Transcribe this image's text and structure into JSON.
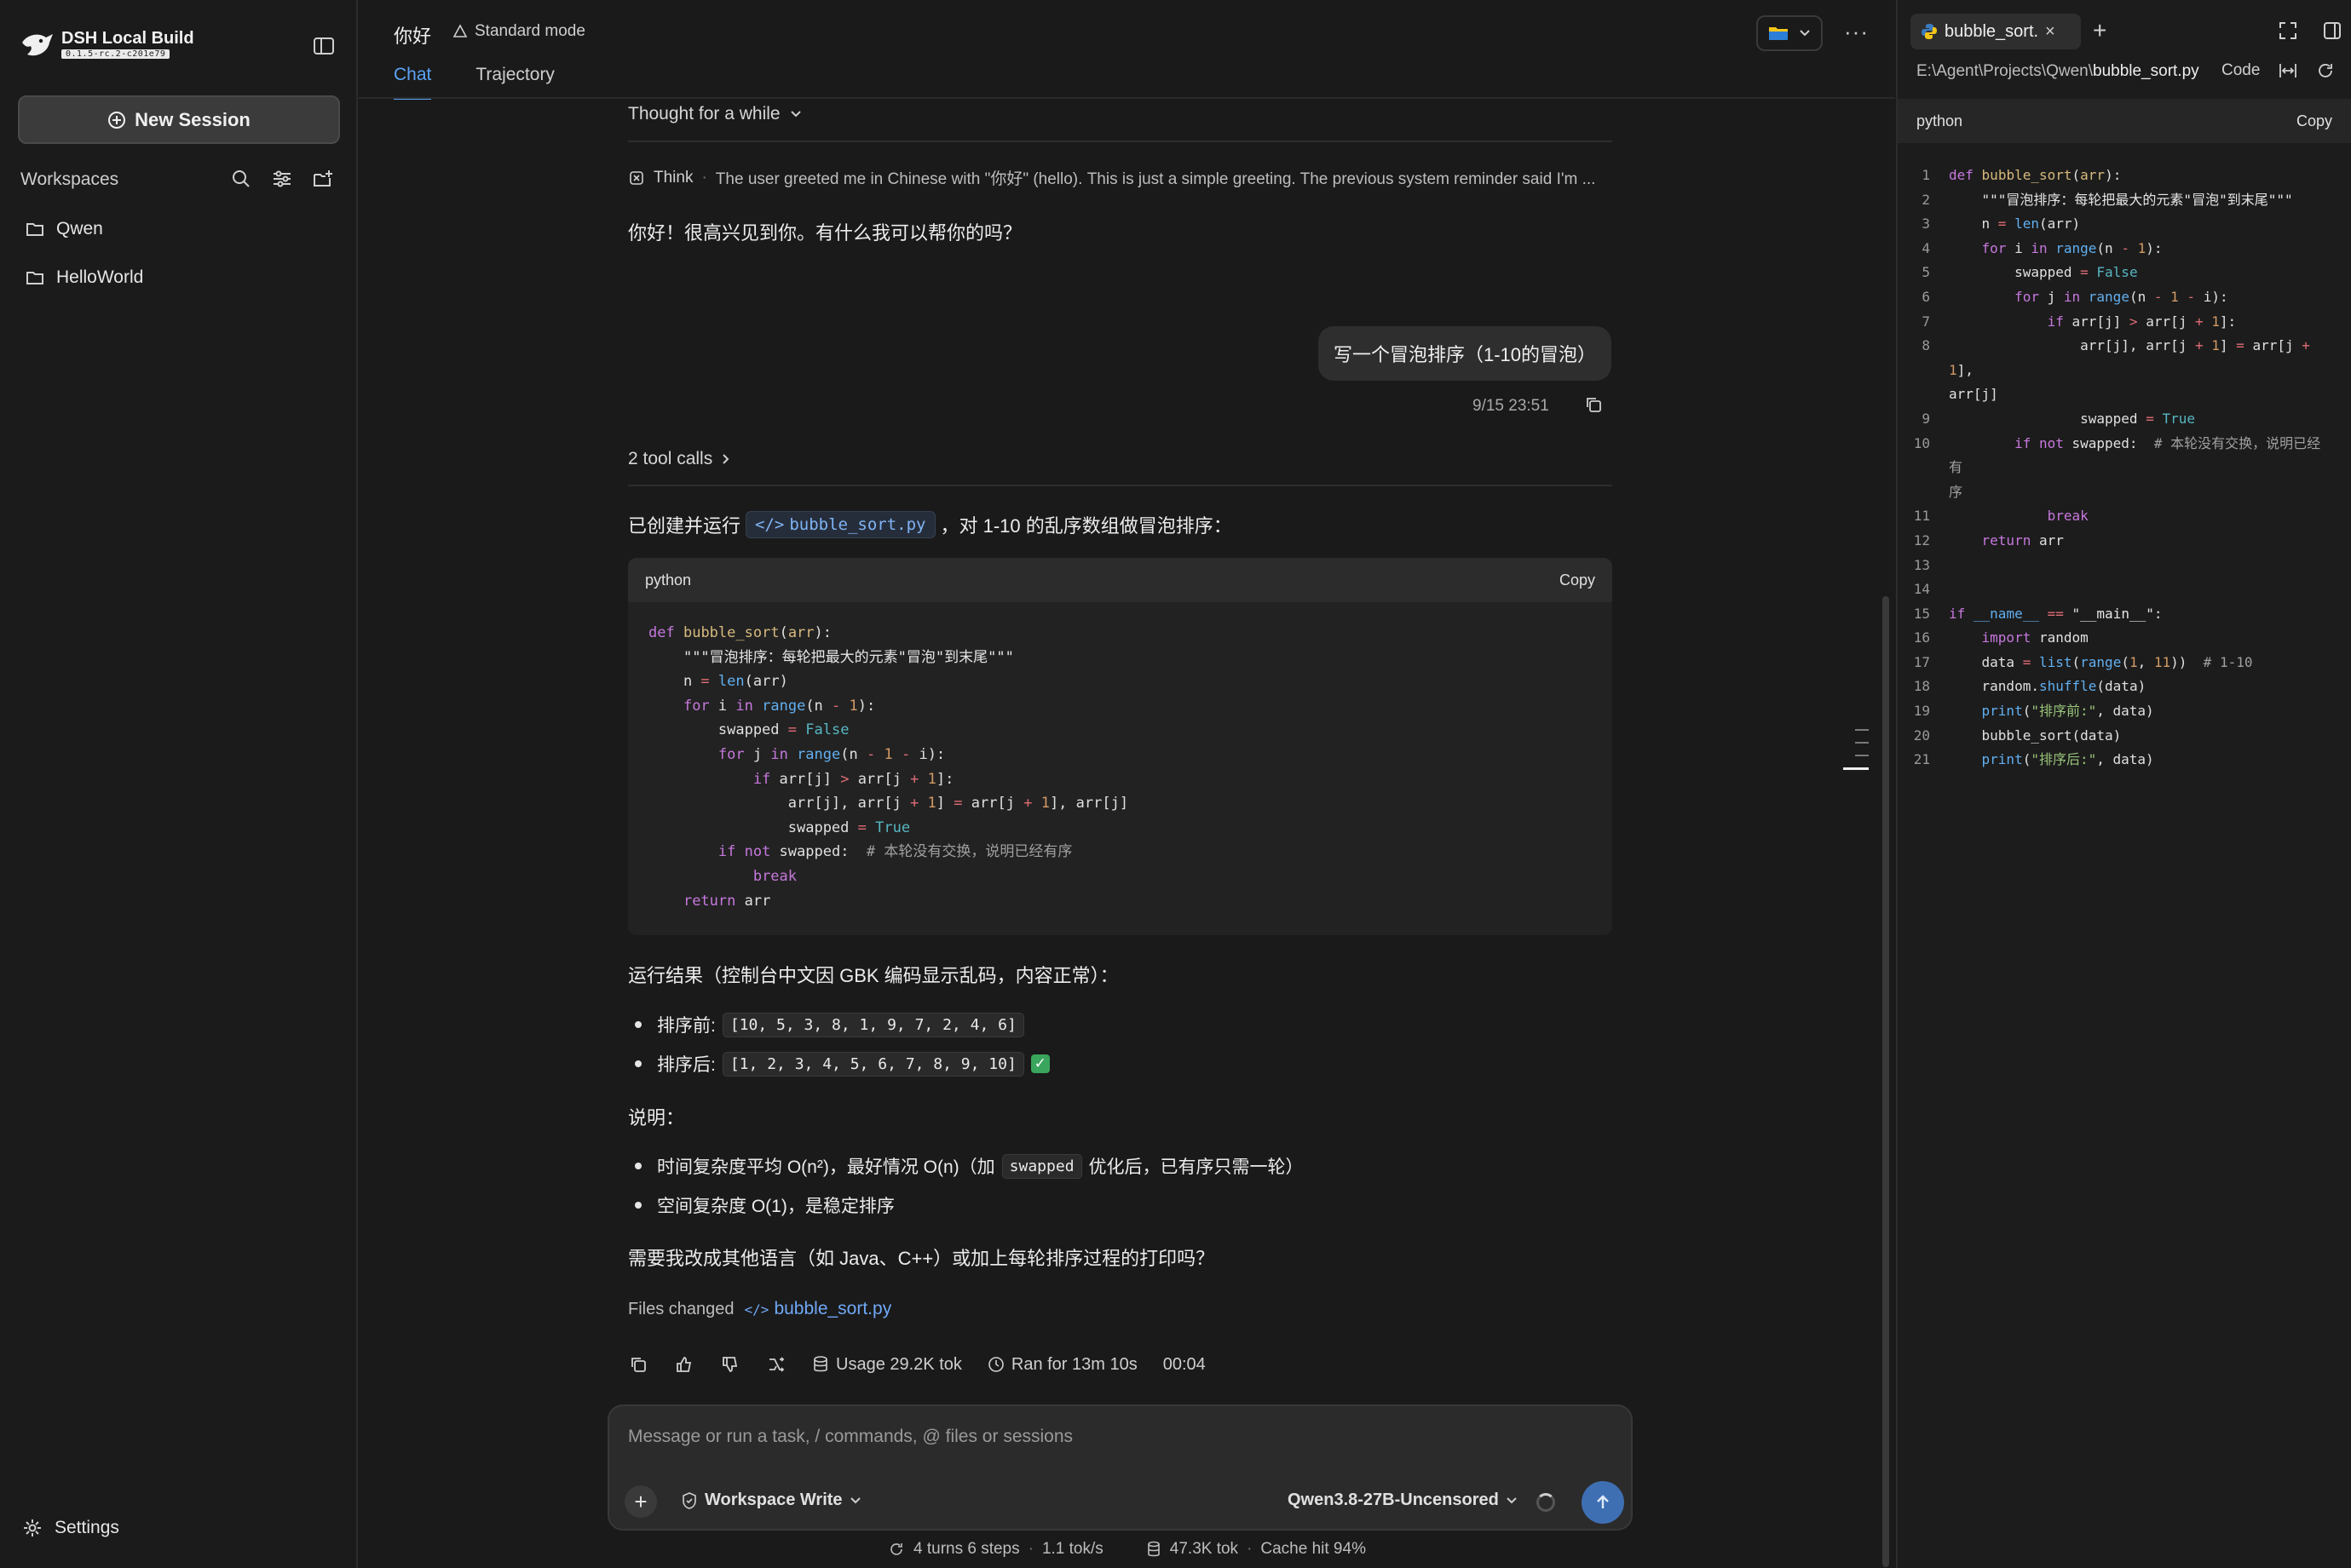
{
  "app": {
    "brand": "DSH Local Build",
    "version": "0.1.5-rc.2-c201e79"
  },
  "sidebar": {
    "new_session": "New Session",
    "workspaces_title": "Workspaces",
    "items": [
      {
        "label": "Qwen"
      },
      {
        "label": "HelloWorld"
      }
    ],
    "settings": "Settings"
  },
  "header": {
    "title": "你好",
    "mode": "Standard mode",
    "tabs": [
      {
        "label": "Chat",
        "active": true
      },
      {
        "label": "Trajectory",
        "active": false
      }
    ]
  },
  "chat": {
    "thought_label": "Thought for a while",
    "think_label": "Think",
    "think_text": "The user greeted me in Chinese with \"你好\" (hello). This is just a simple greeting. The previous system reminder said I'm ...",
    "answer1": "你好！很高兴见到你。有什么我可以帮你的吗？",
    "user_message": "写一个冒泡排序（1-10的冒泡）",
    "timestamp": "9/15 23:51",
    "tool_calls": "2 tool calls",
    "created_prefix": "已创建并运行",
    "created_file": "bubble_sort.py",
    "created_suffix": "，对 1-10 的乱序数组做冒泡排序：",
    "code_lang": "python",
    "copy_label": "Copy",
    "result_title": "运行结果（控制台中文因 GBK 编码显示乱码，内容正常）：",
    "before_label": "排序前:",
    "before_value": "[10, 5, 3, 8, 1, 9, 7, 2, 4, 6]",
    "after_label": "排序后:",
    "after_value": "[1, 2, 3, 4, 5, 6, 7, 8, 9, 10]",
    "explain_title": "说明：",
    "explain_1a": "时间复杂度平均 O(n²)，最好情况 O(n)（加",
    "explain_1code": "swapped",
    "explain_1b": "优化后，已有序只需一轮）",
    "explain_2": "空间复杂度 O(1)，是稳定排序",
    "followup": "需要我改成其他语言（如 Java、C++）或加上每轮排序过程的打印吗？",
    "files_changed_label": "Files changed",
    "files_changed_file": "bubble_sort.py",
    "usage": "Usage 29.2K tok",
    "ran_for": "Ran for 13m 10s",
    "elapsed": "00:04"
  },
  "composer": {
    "placeholder": "Message or run a task, / commands, @ files or sessions",
    "permission": "Workspace Write",
    "model": "Qwen3.8-27B-Uncensored"
  },
  "status": {
    "turns": "4 turns 6 steps",
    "speed": "1.1 tok/s",
    "tokens": "47.3K tok",
    "cache": "Cache hit 94%"
  },
  "right_panel": {
    "tab_name": "bubble_sort.py",
    "path_prefix": "E:\\Agent\\Projects\\Qwen\\",
    "path_file": "bubble_sort.py",
    "view_mode": "Code",
    "lang": "python",
    "copy_label": "Copy"
  },
  "colors": {
    "accent": "#5ba3f5",
    "send": "#3f6fb3",
    "success": "#3aa55c"
  }
}
